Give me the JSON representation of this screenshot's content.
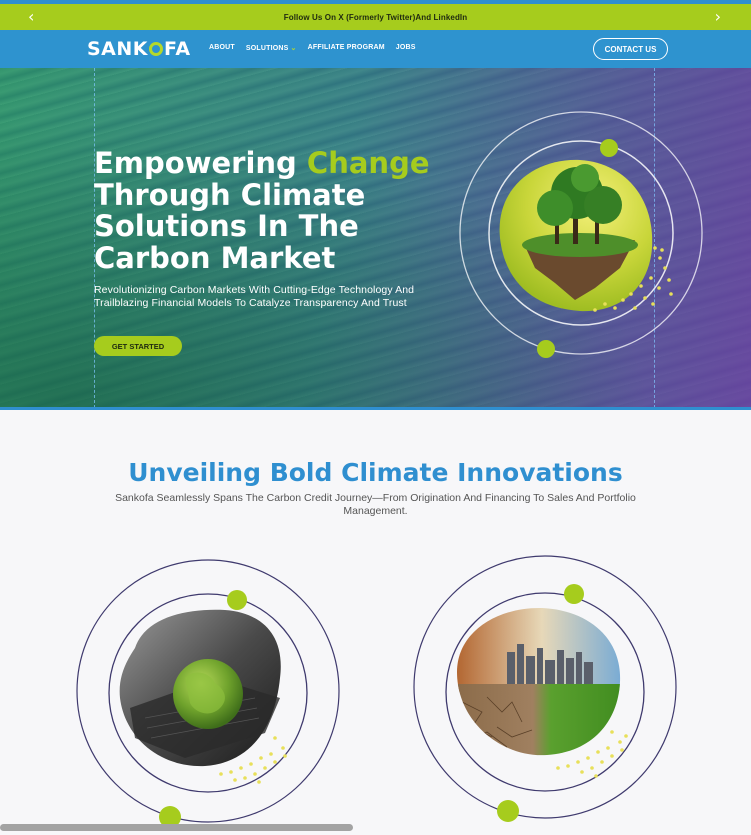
{
  "promo": {
    "text": "Follow Us On X (Formerly Twitter)And LinkedIn",
    "prev_icon": "chevron-left-icon",
    "next_icon": "chevron-right-icon"
  },
  "nav": {
    "logo_part1": "SANK",
    "logo_part2": "FA",
    "items": [
      {
        "label": "ABOUT"
      },
      {
        "label": "SOLUTIONS",
        "icon": "chevron-down-icon"
      },
      {
        "label": "AFFILIATE PROGRAM"
      },
      {
        "label": "JOBS"
      }
    ],
    "contact_label": "CONTACT US"
  },
  "hero": {
    "title_part1": "Empowering ",
    "title_accent": "Change",
    "title_part2": "Through Climate Solutions In The Carbon Market",
    "subtitle": "Revolutionizing Carbon Markets With Cutting-Edge Technology And Trailblazing Financial Models To Catalyze Transparency And Trust",
    "cta_label": "GET STARTED"
  },
  "innovations": {
    "title": "Unveiling Bold Climate Innovations",
    "subtitle": "Sankofa Seamlessly Spans The Carbon Credit Journey—From Origination And Financing To Sales And Portfolio Management."
  },
  "colors": {
    "accent_green": "#a6cc1d",
    "brand_blue": "#2e93cf",
    "title_blue": "#2f8fd0"
  }
}
